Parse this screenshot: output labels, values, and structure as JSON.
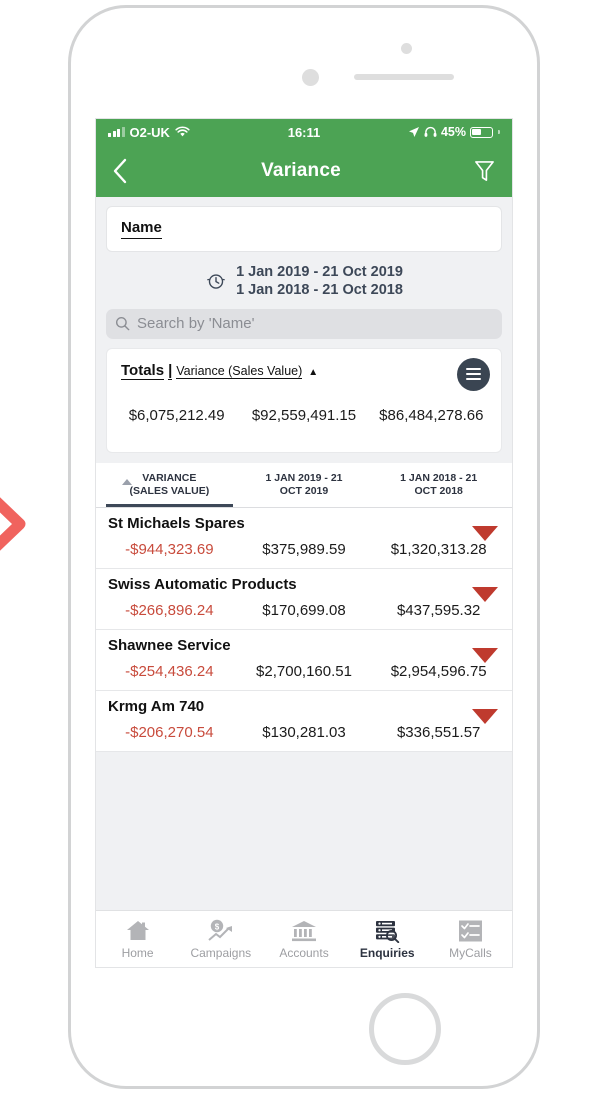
{
  "annotation": {
    "chevron_icon": "chevron-right-icon",
    "color": "#f0635e"
  },
  "device": {
    "frame_color": "#d2d3d4"
  },
  "status_bar": {
    "carrier": "O2-UK",
    "signal_icon": "signal-bars-icon",
    "wifi_icon": "wifi-icon",
    "time": "16:11",
    "location_icon": "location-arrow-icon",
    "headphones_icon": "headphones-icon",
    "battery_percent": "45%",
    "battery_icon": "battery-icon"
  },
  "nav": {
    "back_icon": "chevron-left-icon",
    "title": "Variance",
    "filter_icon": "filter-funnel-icon"
  },
  "name_card": {
    "label": "Name"
  },
  "date_range": {
    "history_icon": "clock-history-icon",
    "line1": "1 Jan 2019 - 21 Oct 2019",
    "line2": "1 Jan 2018 - 21 Oct 2018"
  },
  "search": {
    "icon": "search-icon",
    "placeholder": "Search by 'Name'"
  },
  "totals": {
    "label": "Totals",
    "separator": "|",
    "metric": "Variance (Sales Value)",
    "sort_arrow": "▲",
    "menu_icon": "hamburger-menu-icon",
    "values": [
      "$6,075,212.49",
      "$92,559,491.15",
      "$86,484,278.66"
    ]
  },
  "table": {
    "sort_caret_icon": "sort-ascending-caret-icon",
    "columns": [
      {
        "line1": "VARIANCE",
        "line2": "(SALES VALUE)",
        "active": true
      },
      {
        "line1": "1 JAN 2019 - 21",
        "line2": "OCT 2019",
        "active": false
      },
      {
        "line1": "1 JAN 2018 - 21",
        "line2": "OCT 2018",
        "active": false
      }
    ],
    "rows": [
      {
        "name": "St Michaels Spares",
        "expander_icon": "triangle-down-icon",
        "variance": "-$944,323.69",
        "period_2019": "$375,989.59",
        "period_2018": "$1,320,313.28"
      },
      {
        "name": "Swiss Automatic Products",
        "expander_icon": "triangle-down-icon",
        "variance": "-$266,896.24",
        "period_2019": "$170,699.08",
        "period_2018": "$437,595.32"
      },
      {
        "name": "Shawnee Service",
        "expander_icon": "triangle-down-icon",
        "variance": "-$254,436.24",
        "period_2019": "$2,700,160.51",
        "period_2018": "$2,954,596.75"
      },
      {
        "name": "Krmg Am 740",
        "expander_icon": "triangle-down-icon",
        "variance": "-$206,270.54",
        "period_2019": "$130,281.03",
        "period_2018": "$336,551.57"
      }
    ]
  },
  "tab_bar": {
    "tabs": [
      {
        "label": "Home",
        "icon": "home-icon",
        "active": false
      },
      {
        "label": "Campaigns",
        "icon": "campaigns-chart-icon",
        "active": false
      },
      {
        "label": "Accounts",
        "icon": "bank-icon",
        "active": false
      },
      {
        "label": "Enquiries",
        "icon": "database-search-icon",
        "active": true
      },
      {
        "label": "MyCalls",
        "icon": "checklist-icon",
        "active": false
      }
    ]
  },
  "colors": {
    "header_green": "#4ca354",
    "negative_red": "#c84b3c",
    "expander_red": "#bf3a2e",
    "dark_slate": "#3a4552"
  }
}
